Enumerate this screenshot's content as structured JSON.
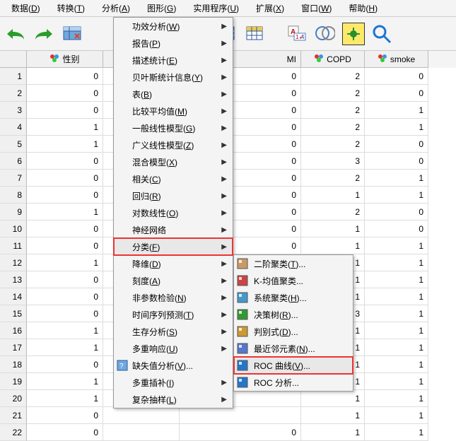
{
  "menubar": [
    {
      "label": "数据(D)",
      "key": "D"
    },
    {
      "label": "转换(T)",
      "key": "T"
    },
    {
      "label": "分析(A)",
      "key": "A"
    },
    {
      "label": "图形(G)",
      "key": "G"
    },
    {
      "label": "实用程序(U)",
      "key": "U"
    },
    {
      "label": "扩展(X)",
      "key": "X"
    },
    {
      "label": "窗口(W)",
      "key": "W"
    },
    {
      "label": "帮助(H)",
      "key": "H"
    }
  ],
  "columns": [
    {
      "name": "性别",
      "type": "nominal"
    },
    {
      "name": "MI",
      "type": "nominal",
      "partial": true
    },
    {
      "name": "COPD",
      "type": "nominal"
    },
    {
      "name": "smoke",
      "type": "nominal"
    }
  ],
  "rows": [
    {
      "n": 1,
      "c1": 0,
      "c2": 0,
      "c3": 2,
      "c4": 0
    },
    {
      "n": 2,
      "c1": 0,
      "c2": 0,
      "c3": 2,
      "c4": 0
    },
    {
      "n": 3,
      "c1": 0,
      "c2": 0,
      "c3": 2,
      "c4": 1
    },
    {
      "n": 4,
      "c1": 1,
      "c2": 0,
      "c3": 2,
      "c4": 1
    },
    {
      "n": 5,
      "c1": 1,
      "c2": 0,
      "c3": 2,
      "c4": 0
    },
    {
      "n": 6,
      "c1": 0,
      "c2": 0,
      "c3": 3,
      "c4": 0
    },
    {
      "n": 7,
      "c1": 0,
      "c2": 0,
      "c3": 2,
      "c4": 1
    },
    {
      "n": 8,
      "c1": 0,
      "c2": 0,
      "c3": 1,
      "c4": 1
    },
    {
      "n": 9,
      "c1": 1,
      "c2": 0,
      "c3": 2,
      "c4": 0
    },
    {
      "n": 10,
      "c1": 0,
      "c2": 0,
      "c3": 1,
      "c4": 0
    },
    {
      "n": 11,
      "c1": 0,
      "c2": 0,
      "c3": 1,
      "c4": 1
    },
    {
      "n": 12,
      "c1": 1,
      "c2": "",
      "c3": 1,
      "c4": 1
    },
    {
      "n": 13,
      "c1": 0,
      "c2": "",
      "c3": 1,
      "c4": 1
    },
    {
      "n": 14,
      "c1": 0,
      "c2": "",
      "c3": 1,
      "c4": 1
    },
    {
      "n": 15,
      "c1": 0,
      "c2": "",
      "c3": 3,
      "c4": 1
    },
    {
      "n": 16,
      "c1": 1,
      "c2": "",
      "c3": 1,
      "c4": 1
    },
    {
      "n": 17,
      "c1": 1,
      "c2": "",
      "c3": 1,
      "c4": 1
    },
    {
      "n": 18,
      "c1": 0,
      "c2": "",
      "c3": 1,
      "c4": 1
    },
    {
      "n": 19,
      "c1": 1,
      "c2": "",
      "c3": 1,
      "c4": 1
    },
    {
      "n": 20,
      "c1": 1,
      "c2": "",
      "c3": 1,
      "c4": 1
    },
    {
      "n": 21,
      "c1": 0,
      "c2": "",
      "c3": 1,
      "c4": 1
    },
    {
      "n": 22,
      "c1": 0,
      "c2": 0,
      "c3": 1,
      "c4": 1
    }
  ],
  "menu": [
    {
      "label": "功效分析(W)",
      "sub": true
    },
    {
      "label": "报告(P)",
      "sub": true
    },
    {
      "label": "描述统计(E)",
      "sub": true
    },
    {
      "label": "贝叶斯统计信息(Y)",
      "sub": true
    },
    {
      "label": "表(B)",
      "sub": true
    },
    {
      "label": "比较平均值(M)",
      "sub": true
    },
    {
      "label": "一般线性模型(G)",
      "sub": true
    },
    {
      "label": "广义线性模型(Z)",
      "sub": true
    },
    {
      "label": "混合模型(X)",
      "sub": true
    },
    {
      "label": "相关(C)",
      "sub": true
    },
    {
      "label": "回归(R)",
      "sub": true
    },
    {
      "label": "对数线性(O)",
      "sub": true
    },
    {
      "label": "神经网络",
      "sub": true
    },
    {
      "label": "分类(F)",
      "sub": true,
      "highlight": true
    },
    {
      "label": "降维(D)",
      "sub": true
    },
    {
      "label": "刻度(A)",
      "sub": true
    },
    {
      "label": "非参数检验(N)",
      "sub": true
    },
    {
      "label": "时间序列预测(T)",
      "sub": true
    },
    {
      "label": "生存分析(S)",
      "sub": true
    },
    {
      "label": "多重响应(U)",
      "sub": true
    },
    {
      "label": "缺失值分析(V)...",
      "sub": false,
      "icon": true
    },
    {
      "label": "多重插补(I)",
      "sub": true
    },
    {
      "label": "复杂抽样(L)",
      "sub": true
    }
  ],
  "submenu": [
    {
      "label": "二阶聚类(T)..."
    },
    {
      "label": "K-均值聚类..."
    },
    {
      "label": "系统聚类(H)..."
    },
    {
      "label": "决策树(R)..."
    },
    {
      "label": "判别式(D)..."
    },
    {
      "label": "最近邻元素(N)..."
    },
    {
      "label": "ROC 曲线(V)...",
      "highlight": true
    },
    {
      "label": "ROC 分析..."
    }
  ]
}
